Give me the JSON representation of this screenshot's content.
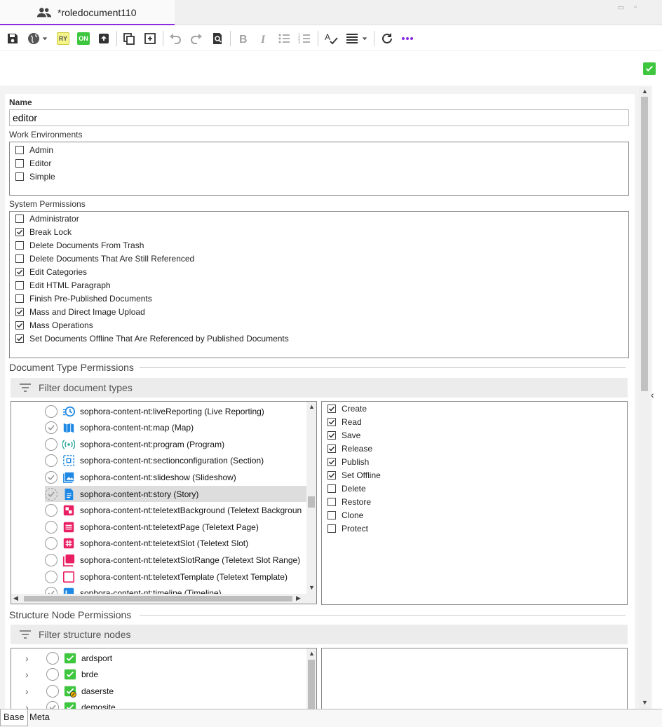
{
  "tab": {
    "title": "*roledocument110"
  },
  "window": {
    "minimize": "▭",
    "maximize": "▫"
  },
  "form": {
    "name_label": "Name",
    "name_value": "editor",
    "work_env_label": "Work Environments",
    "work_envs": [
      {
        "label": "Admin",
        "checked": false
      },
      {
        "label": "Editor",
        "checked": false
      },
      {
        "label": "Simple",
        "checked": false
      }
    ],
    "sys_perm_label": "System Permissions",
    "sys_perms": [
      {
        "label": "Administrator",
        "checked": false
      },
      {
        "label": "Break Lock",
        "checked": true
      },
      {
        "label": "Delete Documents From Trash",
        "checked": false
      },
      {
        "label": "Delete Documents That Are Still Referenced",
        "checked": false
      },
      {
        "label": "Edit Categories",
        "checked": true
      },
      {
        "label": "Edit HTML Paragraph",
        "checked": false
      },
      {
        "label": "Finish Pre-Published Documents",
        "checked": false
      },
      {
        "label": "Mass and Direct Image Upload",
        "checked": true
      },
      {
        "label": "Mass Operations",
        "checked": true
      },
      {
        "label": "Set Documents Offline That Are Referenced by Published Documents",
        "checked": true
      }
    ],
    "doc_type_section": "Document Type Permissions",
    "doc_type_filter": "Filter document types",
    "doc_types": [
      {
        "label": "sophora-content-nt:liveReporting (Live Reporting)",
        "icon": "clock-icon",
        "color": "#1e88e5",
        "state": "empty",
        "selected": false
      },
      {
        "label": "sophora-content-nt:map (Map)",
        "icon": "map-icon",
        "color": "#1e88e5",
        "state": "check",
        "selected": false
      },
      {
        "label": "sophora-content-nt:program (Program)",
        "icon": "broadcast-icon",
        "color": "#26a69a",
        "state": "empty",
        "selected": false
      },
      {
        "label": "sophora-content-nt:sectionconfiguration (Section)",
        "icon": "section-icon",
        "color": "#1e88e5",
        "state": "empty",
        "selected": false
      },
      {
        "label": "sophora-content-nt:slideshow (Slideshow)",
        "icon": "image-icon",
        "color": "#1e88e5",
        "state": "check",
        "selected": false
      },
      {
        "label": "sophora-content-nt:story (Story)",
        "icon": "document-icon",
        "color": "#1e88e5",
        "state": "dashed",
        "selected": true
      },
      {
        "label": "sophora-content-nt:teletextBackground (Teletext Backgroun",
        "icon": "teletext-bg-icon",
        "color": "#e91e63",
        "state": "empty",
        "selected": false
      },
      {
        "label": "sophora-content-nt:teletextPage (Teletext Page)",
        "icon": "teletext-page-icon",
        "color": "#e91e63",
        "state": "empty",
        "selected": false
      },
      {
        "label": "sophora-content-nt:teletextSlot (Teletext Slot)",
        "icon": "hash-icon",
        "color": "#e91e63",
        "state": "empty",
        "selected": false
      },
      {
        "label": "sophora-content-nt:teletextSlotRange (Teletext Slot Range)",
        "icon": "slot-range-icon",
        "color": "#e91e63",
        "state": "empty",
        "selected": false
      },
      {
        "label": "sophora-content-nt:teletextTemplate (Teletext Template)",
        "icon": "template-icon",
        "color": "#e91e63",
        "state": "empty",
        "selected": false
      },
      {
        "label": "sophora-content-nt:timeline (Timeline)",
        "icon": "timeline-icon",
        "color": "#1e88e5",
        "state": "check",
        "selected": false
      }
    ],
    "doc_perms": [
      {
        "label": "Create",
        "checked": true
      },
      {
        "label": "Read",
        "checked": true
      },
      {
        "label": "Save",
        "checked": true
      },
      {
        "label": "Release",
        "checked": true
      },
      {
        "label": "Publish",
        "checked": true
      },
      {
        "label": "Set Offline",
        "checked": true
      },
      {
        "label": "Delete",
        "checked": false
      },
      {
        "label": "Restore",
        "checked": false
      },
      {
        "label": "Clone",
        "checked": false
      },
      {
        "label": "Protect",
        "checked": false
      }
    ],
    "struct_section": "Structure Node Permissions",
    "struct_filter": "Filter structure nodes",
    "struct_nodes": [
      {
        "label": "ardsport",
        "state": "empty",
        "icon": "green-check-icon"
      },
      {
        "label": "brde",
        "state": "empty",
        "icon": "green-check-icon"
      },
      {
        "label": "daserste",
        "state": "empty",
        "icon": "green-check-warning-icon"
      },
      {
        "label": "demosite",
        "state": "check",
        "icon": "green-check-icon"
      }
    ]
  },
  "bottom_tabs": [
    {
      "label": "Base",
      "active": true
    },
    {
      "label": "Meta",
      "active": false
    }
  ],
  "colors": {
    "accent": "#8a2be2",
    "ok": "#3ec63e",
    "ry_badge": "#f5f58a",
    "on_badge": "#3ec63e"
  },
  "toolbar": {
    "ry": "RY",
    "on": "ON"
  }
}
